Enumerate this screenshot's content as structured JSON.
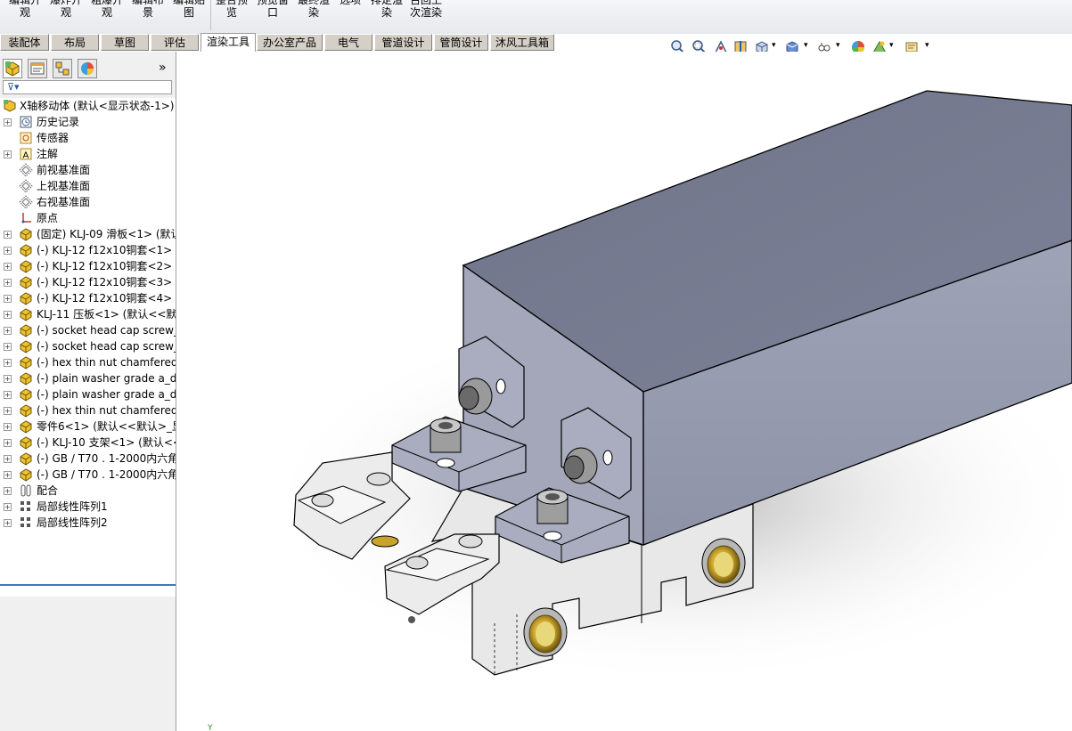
{
  "ribbon": {
    "buttons": [
      {
        "label": "编辑开\n观"
      },
      {
        "label": "爆炸开\n观"
      },
      {
        "label": "粗爆开\n观"
      },
      {
        "label": "编辑布\n景"
      },
      {
        "label": "编辑贴\n图"
      },
      {
        "label": "整合预\n览"
      },
      {
        "label": "预览窗\n口"
      },
      {
        "label": "最终渲\n染"
      },
      {
        "label": "选项"
      },
      {
        "label": "排定渲\n染"
      },
      {
        "label": "召回上\n次渲染"
      }
    ]
  },
  "tabs": [
    {
      "label": "装配体"
    },
    {
      "label": "布局"
    },
    {
      "label": "草图"
    },
    {
      "label": "评估"
    },
    {
      "label": "渲染工具",
      "active": true
    },
    {
      "label": "办公室产品"
    },
    {
      "label": "电气"
    },
    {
      "label": "管道设计"
    },
    {
      "label": "管筒设计"
    },
    {
      "label": "沐风工具箱"
    }
  ],
  "panel": {
    "expand_glyph": "»",
    "filter_glyph": "⊽▾"
  },
  "tree": {
    "root": "X轴移动体 (默认<显示状态-1>)",
    "items": [
      {
        "label": "历史记录",
        "icon": "history-icon",
        "expand": true
      },
      {
        "label": "传感器",
        "icon": "sensor-icon",
        "expand": false
      },
      {
        "label": "注解",
        "icon": "annotation-icon",
        "expand": true
      },
      {
        "label": "前视基准面",
        "icon": "plane-icon",
        "expand": false
      },
      {
        "label": "上视基准面",
        "icon": "plane-icon",
        "expand": false
      },
      {
        "label": "右视基准面",
        "icon": "plane-icon",
        "expand": false
      },
      {
        "label": "原点",
        "icon": "origin-icon",
        "expand": false
      },
      {
        "label": "(固定) KLJ-09 滑板<1> (默认",
        "icon": "part-icon",
        "expand": true
      },
      {
        "label": "(-) KLJ-12 f12x10铜套<1> (",
        "icon": "part-icon",
        "expand": true
      },
      {
        "label": "(-) KLJ-12 f12x10铜套<2> (",
        "icon": "part-icon",
        "expand": true
      },
      {
        "label": "(-) KLJ-12 f12x10铜套<3> (",
        "icon": "part-icon",
        "expand": true
      },
      {
        "label": "(-) KLJ-12 f12x10铜套<4> (",
        "icon": "part-icon",
        "expand": true
      },
      {
        "label": "KLJ-11 压板<1> (默认<<默",
        "icon": "part-icon",
        "expand": true
      },
      {
        "label": "(-) socket head cap screw_",
        "icon": "part-icon",
        "expand": true
      },
      {
        "label": "(-) socket head cap screw_",
        "icon": "part-icon",
        "expand": true
      },
      {
        "label": "(-) hex thin nut chamfered",
        "icon": "part-icon",
        "expand": true
      },
      {
        "label": "(-) plain washer grade a_d",
        "icon": "part-icon",
        "expand": true
      },
      {
        "label": "(-) plain washer grade a_d",
        "icon": "part-icon",
        "expand": true
      },
      {
        "label": "(-) hex thin nut chamfered",
        "icon": "part-icon",
        "expand": true
      },
      {
        "label": "零件6<1> (默认<<默认>_显",
        "icon": "part-icon",
        "expand": true
      },
      {
        "label": "(-) KLJ-10 支架<1> (默认<<",
        "icon": "part-icon",
        "expand": true
      },
      {
        "label": "(-) GB / T70 . 1-2000内六角",
        "icon": "part-icon",
        "expand": true
      },
      {
        "label": "(-) GB / T70 . 1-2000内六角",
        "icon": "part-icon",
        "expand": true
      },
      {
        "label": "配合",
        "icon": "mates-icon",
        "expand": true
      },
      {
        "label": "局部线性阵列1",
        "icon": "pattern-icon",
        "expand": true
      },
      {
        "label": "局部线性阵列2",
        "icon": "pattern-icon",
        "expand": true
      }
    ]
  },
  "viewport": {
    "axis_label": "Y"
  },
  "colors": {
    "body_top": "#7b8095",
    "body_side": "#9a9fb3",
    "bracket": "#a7abbd",
    "base": "#e6e6e6",
    "bushing": "#c8a020"
  }
}
